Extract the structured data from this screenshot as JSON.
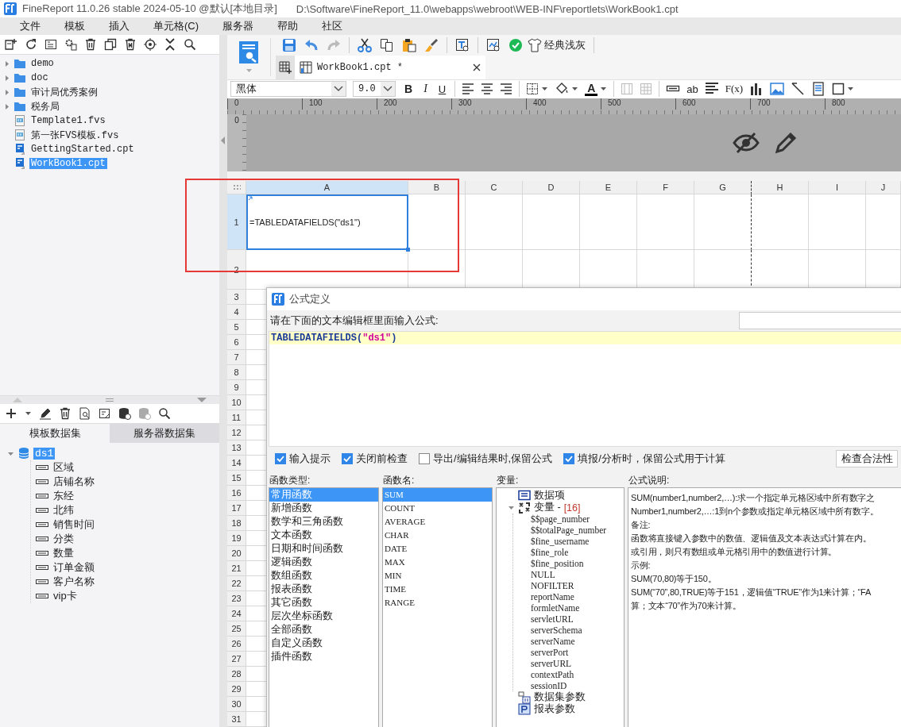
{
  "window": {
    "title": "FineReport 11.0.26 stable 2024-05-10 @默认[本地目录]",
    "path": "D:\\Software\\FineReport_11.0\\webapps\\webroot\\WEB-INF\\reportlets\\WorkBook1.cpt"
  },
  "menu": [
    "文件",
    "模板",
    "插入",
    "单元格(C)",
    "服务器",
    "帮助",
    "社区"
  ],
  "file_tree": [
    {
      "name": "demo",
      "kind": "folder",
      "selected": false
    },
    {
      "name": "doc",
      "kind": "folder",
      "selected": false
    },
    {
      "name": "审计局优秀案例",
      "kind": "folder",
      "selected": false
    },
    {
      "name": "税务局",
      "kind": "folder",
      "selected": false
    },
    {
      "name": "Template1.fvs",
      "kind": "fvs",
      "selected": false
    },
    {
      "name": "第一张FVS模板.fvs",
      "kind": "fvs",
      "selected": false
    },
    {
      "name": "GettingStarted.cpt",
      "kind": "cpt",
      "selected": false
    },
    {
      "name": "WorkBook1.cpt",
      "kind": "cpt",
      "selected": true
    }
  ],
  "dataset_tabs": [
    {
      "label": "模板数据集",
      "selected": true
    },
    {
      "label": "服务器数据集",
      "selected": false
    }
  ],
  "datasets": [
    {
      "name": "ds1",
      "selected": true,
      "expanded": true,
      "children": [
        {
          "name": "区域"
        },
        {
          "name": "店铺名称"
        },
        {
          "name": "东经"
        },
        {
          "name": "北纬"
        },
        {
          "name": "销售时间"
        },
        {
          "name": "分类"
        },
        {
          "name": "数量"
        },
        {
          "name": "订单金额"
        },
        {
          "name": "客户名称"
        },
        {
          "name": "vip卡"
        }
      ]
    }
  ],
  "toolbar": {
    "theme_button": "经典浅灰"
  },
  "document_tabs": [
    {
      "label": "WorkBook1.cpt *",
      "selected": true
    }
  ],
  "format_bar": {
    "font": "黑体",
    "size": "9.0",
    "style_buttons": [
      "B",
      "I",
      "U"
    ],
    "font_color_button": "A",
    "text_field_button": "ab",
    "formula_button": "F(x)"
  },
  "ruler": {
    "side_label": "0",
    "ticks": [
      "0",
      "100",
      "200",
      "300",
      "400",
      "500",
      "600",
      "700",
      "800"
    ]
  },
  "sheet": {
    "columns": [
      {
        "label": "A",
        "selected": true
      },
      {
        "label": "B",
        "selected": false
      },
      {
        "label": "C",
        "selected": false
      },
      {
        "label": "D",
        "selected": false
      },
      {
        "label": "E",
        "selected": false
      },
      {
        "label": "F",
        "selected": false
      },
      {
        "label": "G",
        "selected": false
      },
      {
        "label": "H",
        "selected": false
      },
      {
        "label": "I",
        "selected": false
      },
      {
        "label": "J",
        "selected": false
      }
    ],
    "rows": [
      {
        "label": "1",
        "selected": true,
        "cells": [
          {
            "text": "=TABLEDATAFIELDS(\"ds1\")",
            "selected": true
          }
        ]
      },
      {
        "label": "2",
        "selected": false
      },
      {
        "label": "3",
        "selected": false
      },
      {
        "label": "4",
        "selected": false
      },
      {
        "label": "5",
        "selected": false
      },
      {
        "label": "6",
        "selected": false
      },
      {
        "label": "7",
        "selected": false
      },
      {
        "label": "8",
        "selected": false
      },
      {
        "label": "9",
        "selected": false
      },
      {
        "label": "10",
        "selected": false
      },
      {
        "label": "11",
        "selected": false
      },
      {
        "label": "12",
        "selected": false
      },
      {
        "label": "13",
        "selected": false
      },
      {
        "label": "14",
        "selected": false
      },
      {
        "label": "15",
        "selected": false
      },
      {
        "label": "16",
        "selected": false
      },
      {
        "label": "17",
        "selected": false
      },
      {
        "label": "18",
        "selected": false
      },
      {
        "label": "19",
        "selected": false
      },
      {
        "label": "20",
        "selected": false
      },
      {
        "label": "21",
        "selected": false
      },
      {
        "label": "22",
        "selected": false
      },
      {
        "label": "23",
        "selected": false
      },
      {
        "label": "24",
        "selected": false
      },
      {
        "label": "25",
        "selected": false
      },
      {
        "label": "26",
        "selected": false
      },
      {
        "label": "27",
        "selected": false
      },
      {
        "label": "28",
        "selected": false
      },
      {
        "label": "29",
        "selected": false
      },
      {
        "label": "30",
        "selected": false
      },
      {
        "label": "31",
        "selected": false
      }
    ]
  },
  "dialog": {
    "title": "公式定义",
    "prompt": "请在下面的文本编辑框里面输入公式:",
    "formula": [
      {
        "kind": "code",
        "text": "TABLEDATAFIELDS("
      },
      {
        "kind": "string",
        "text": "\"ds1\""
      },
      {
        "kind": "code",
        "text": ")"
      }
    ],
    "options": [
      {
        "label": "输入提示",
        "checked": true
      },
      {
        "label": "关闭前检查",
        "checked": true
      },
      {
        "label": "导出/编辑结果时,保留公式",
        "checked": false
      },
      {
        "label": "填报/分析时，保留公式用于计算",
        "checked": true
      }
    ],
    "check_button": "检查合法性",
    "function_types": {
      "label": "函数类型:",
      "items": [
        {
          "label": "常用函数",
          "selected": true
        },
        {
          "label": "新增函数",
          "selected": false
        },
        {
          "label": "数学和三角函数",
          "selected": false
        },
        {
          "label": "文本函数",
          "selected": false
        },
        {
          "label": "日期和时间函数",
          "selected": false
        },
        {
          "label": "逻辑函数",
          "selected": false
        },
        {
          "label": "数组函数",
          "selected": false
        },
        {
          "label": "报表函数",
          "selected": false
        },
        {
          "label": "其它函数",
          "selected": false
        },
        {
          "label": "层次坐标函数",
          "selected": false
        },
        {
          "label": "全部函数",
          "selected": false
        },
        {
          "label": "自定义函数",
          "selected": false
        },
        {
          "label": "插件函数",
          "selected": false
        }
      ]
    },
    "function_names": {
      "label": "函数名:",
      "items": [
        {
          "label": "SUM",
          "selected": true
        },
        {
          "label": "COUNT",
          "selected": false
        },
        {
          "label": "AVERAGE",
          "selected": false
        },
        {
          "label": "CHAR",
          "selected": false
        },
        {
          "label": "DATE",
          "selected": false
        },
        {
          "label": "MAX",
          "selected": false
        },
        {
          "label": "MIN",
          "selected": false
        },
        {
          "label": "TIME",
          "selected": false
        },
        {
          "label": "RANGE",
          "selected": false
        }
      ]
    },
    "variables": {
      "label": "变量:",
      "items": [
        {
          "label": "数据项",
          "kind": "data"
        },
        {
          "label": "变量 -",
          "count": "[16]",
          "kind": "variables",
          "expanded": true,
          "children": [
            "$$page_number",
            "$$totalPage_number",
            "$fine_username",
            "$fine_role",
            "$fine_position",
            "NULL",
            "NOFILTER",
            "reportName",
            "formletName",
            "servletURL",
            "serverSchema",
            "serverName",
            "serverPort",
            "serverURL",
            "contextPath",
            "sessionID"
          ]
        },
        {
          "label": "数据集参数",
          "kind": "dataset_params"
        },
        {
          "label": "报表参数",
          "kind": "report_params"
        }
      ]
    },
    "description": {
      "label": "公式说明:",
      "lines": [
        "SUM(number1,number2,…):求一个指定单元格区域中所有数字之",
        "Number1,number2,…:1到n个参数或指定单元格区域中所有数字。",
        "备注:",
        "函数将直接键入参数中的数值、逻辑值及文本表达式计算在内。",
        "或引用，则只有数组或单元格引用中的数值进行计算。",
        "示例:",
        "SUM(70,80)等于150。",
        "SUM(“70”,80,TRUE)等于151，逻辑值“TRUE”作为1来计算；“FA",
        "算；文本“70”作为70来计算。"
      ]
    }
  }
}
